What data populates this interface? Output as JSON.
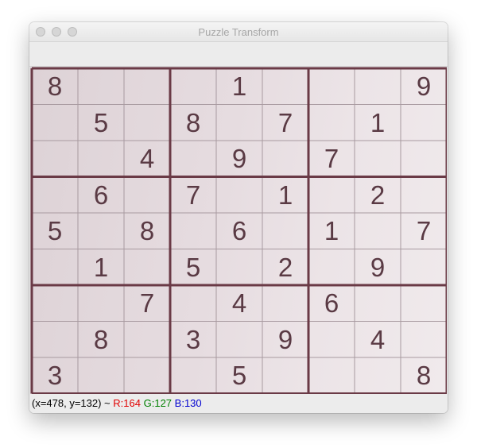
{
  "window": {
    "title": "Puzzle Transform"
  },
  "puzzle": {
    "rows": [
      [
        "8",
        "",
        "",
        "",
        "1",
        "",
        "",
        "",
        "9"
      ],
      [
        "",
        "5",
        "",
        "8",
        "",
        "7",
        "",
        "1",
        ""
      ],
      [
        "",
        "",
        "4",
        "",
        "9",
        "",
        "7",
        "",
        ""
      ],
      [
        "",
        "6",
        "",
        "7",
        "",
        "1",
        "",
        "2",
        ""
      ],
      [
        "5",
        "",
        "8",
        "",
        "6",
        "",
        "1",
        "",
        "7"
      ],
      [
        "",
        "1",
        "",
        "5",
        "",
        "2",
        "",
        "9",
        ""
      ],
      [
        "",
        "",
        "7",
        "",
        "4",
        "",
        "6",
        "",
        ""
      ],
      [
        "",
        "8",
        "",
        "3",
        "",
        "9",
        "",
        "4",
        ""
      ],
      [
        "3",
        "",
        "",
        "",
        "5",
        "",
        "",
        "",
        "8"
      ]
    ]
  },
  "status": {
    "coords": "(x=478, y=132) ~",
    "r": "R:164",
    "g": "G:127",
    "b": "B:130",
    "colors": {
      "r": "#e00000",
      "g": "#008000",
      "b": "#0000d0"
    }
  }
}
